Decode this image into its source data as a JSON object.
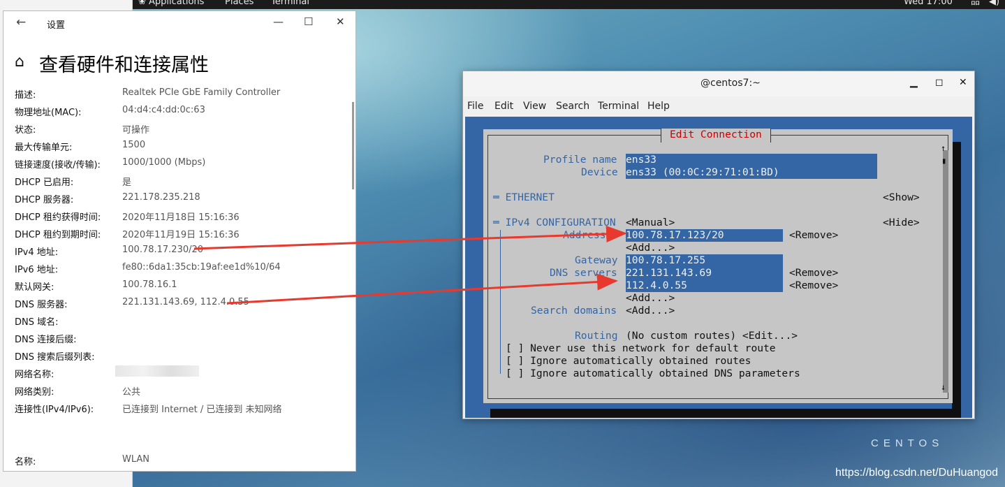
{
  "topbar": {
    "applications": "Applications",
    "places": "Places",
    "terminal": "Terminal",
    "clock": "Wed 17:00"
  },
  "settings": {
    "title": "设置",
    "heading": "查看硬件和连接属性",
    "rows": [
      {
        "label": "描述:",
        "value": "Realtek PCIe GbE Family Controller"
      },
      {
        "label": "物理地址(MAC):",
        "value": "04:d4:c4:dd:0c:63"
      },
      {
        "label": "状态:",
        "value": "可操作"
      },
      {
        "label": "最大传输单元:",
        "value": "1500"
      },
      {
        "label": "链接速度(接收/传输):",
        "value": "1000/1000 (Mbps)"
      },
      {
        "label": "DHCP 已启用:",
        "value": "是"
      },
      {
        "label": "DHCP 服务器:",
        "value": "221.178.235.218"
      },
      {
        "label": "DHCP 租约获得时间:",
        "value": "2020年11月18日 15:16:36"
      },
      {
        "label": "DHCP 租约到期时间:",
        "value": "2020年11月19日 15:16:36"
      },
      {
        "label": "IPv4 地址:",
        "value": "100.78.17.230/20"
      },
      {
        "label": "IPv6 地址:",
        "value": "fe80::6da1:35cb:19af:ee1d%10/64"
      },
      {
        "label": "默认网关:",
        "value": "100.78.16.1"
      },
      {
        "label": "DNS 服务器:",
        "value": "221.131.143.69, 112.4.0.55"
      },
      {
        "label": "DNS 域名:",
        "value": ""
      },
      {
        "label": "DNS 连接后缀:",
        "value": ""
      },
      {
        "label": "DNS 搜索后缀列表:",
        "value": ""
      },
      {
        "label": "网络名称:",
        "value": ""
      },
      {
        "label": "网络类别:",
        "value": "公共"
      },
      {
        "label": "连接性(IPv4/IPv6):",
        "value": "已连接到 Internet / 已连接到 未知网络"
      },
      {
        "label": "名称:",
        "value": "WLAN"
      }
    ]
  },
  "terminal": {
    "title": "@centos7:~",
    "menu": [
      "File",
      "Edit",
      "View",
      "Search",
      "Terminal",
      "Help"
    ],
    "dialog_title": "Edit Connection",
    "profile_name_label": "Profile name",
    "profile_name": "ens33",
    "device_label": "Device",
    "device": "ens33 (00:0C:29:71:01:BD)",
    "ethernet": "═ ETHERNET",
    "show": "<Show>",
    "ipv4": "═ IPv4 CONFIGURATION",
    "manual": "<Manual>",
    "hide": "<Hide>",
    "addresses_label": "Addresses",
    "address": "100.78.17.123/20",
    "remove": "<Remove>",
    "add": "<Add...>",
    "gateway_label": "Gateway",
    "gateway": "100.78.17.255",
    "dns_label": "DNS servers",
    "dns1": "221.131.143.69",
    "dns2": "112.4.0.55",
    "search_domains_label": "Search domains",
    "routing_label": "Routing",
    "routing_value": "(No custom routes) <Edit...>",
    "check1": "[ ] Never use this network for default route",
    "check2": "[ ] Ignore automatically obtained routes",
    "check3": "[ ] Ignore automatically obtained DNS parameters"
  },
  "desktop": {
    "centos_logo": "CENTOS",
    "watermark": "https://blog.csdn.net/DuHuangod"
  },
  "colors": {
    "terminal_blue": "#3465a4",
    "dialog_gray": "#c6c6c6",
    "dialog_title_red": "#cc0000",
    "arrow_red": "#e8392f"
  }
}
